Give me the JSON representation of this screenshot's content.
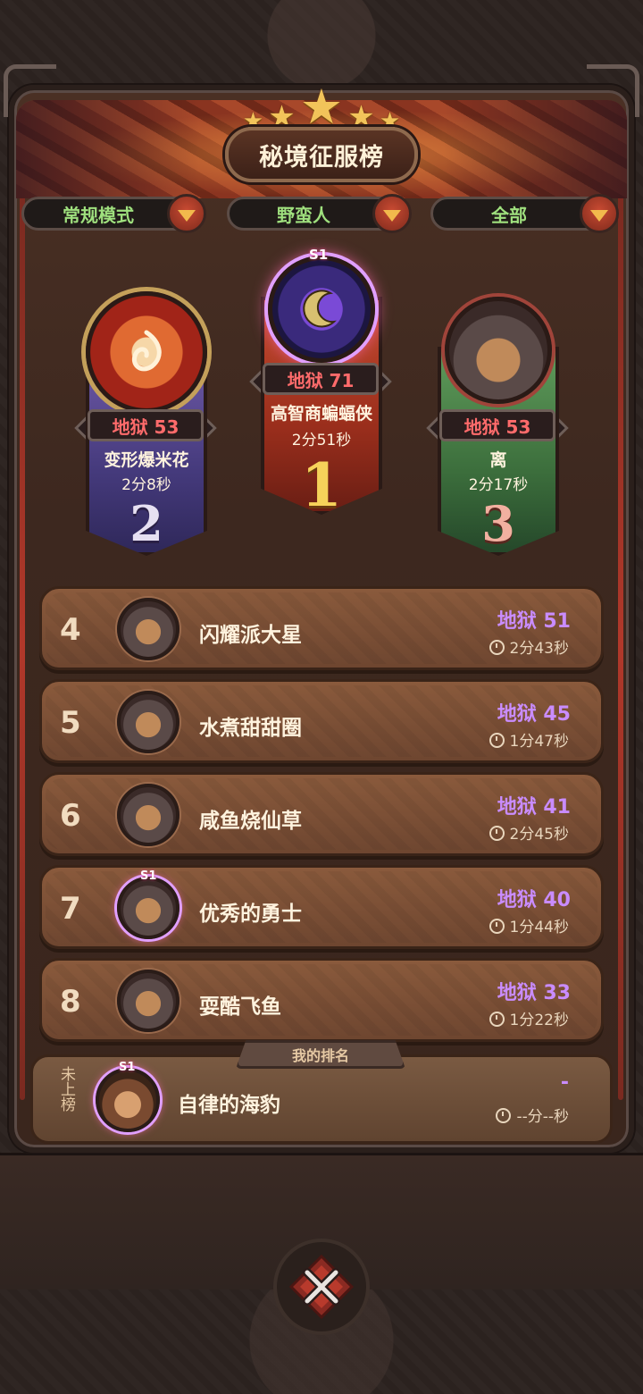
{
  "header": {
    "title": "秘境征服榜"
  },
  "filters": [
    {
      "label": "常规模式"
    },
    {
      "label": "野蛮人"
    },
    {
      "label": "全部"
    }
  ],
  "podium": {
    "first": {
      "rank": "1",
      "level": "地狱 71",
      "name": "高智商蝙蝠侠",
      "time": "2分51秒",
      "season": "S1"
    },
    "second": {
      "rank": "2",
      "level": "地狱 53",
      "name": "变形爆米花",
      "time": "2分8秒"
    },
    "third": {
      "rank": "3",
      "level": "地狱 53",
      "name": "离",
      "time": "2分17秒"
    }
  },
  "list": [
    {
      "rank": "4",
      "name": "闪耀派大星",
      "level": "地狱 51",
      "time": "2分43秒"
    },
    {
      "rank": "5",
      "name": "水煮甜甜圈",
      "level": "地狱 45",
      "time": "1分47秒"
    },
    {
      "rank": "6",
      "name": "咸鱼烧仙草",
      "level": "地狱 41",
      "time": "2分45秒"
    },
    {
      "rank": "7",
      "name": "优秀的勇士",
      "level": "地狱 40",
      "time": "1分44秒",
      "season": "S1"
    },
    {
      "rank": "8",
      "name": "耍酷飞鱼",
      "level": "地狱 33",
      "time": "1分22秒"
    }
  ],
  "my_rank": {
    "tab_label": "我的排名",
    "status": "未上榜",
    "name": "自律的海豹",
    "level": "-",
    "time": "--分--秒",
    "season": "S1"
  },
  "colors": {
    "level_purple": "#c98cff",
    "level_red": "#ff6b6b",
    "filter_green": "#9fe07e",
    "gold": "#f2c45a"
  },
  "icons": [
    "star-icon",
    "dropdown-arrow-icon",
    "clock-icon",
    "close-icon"
  ]
}
